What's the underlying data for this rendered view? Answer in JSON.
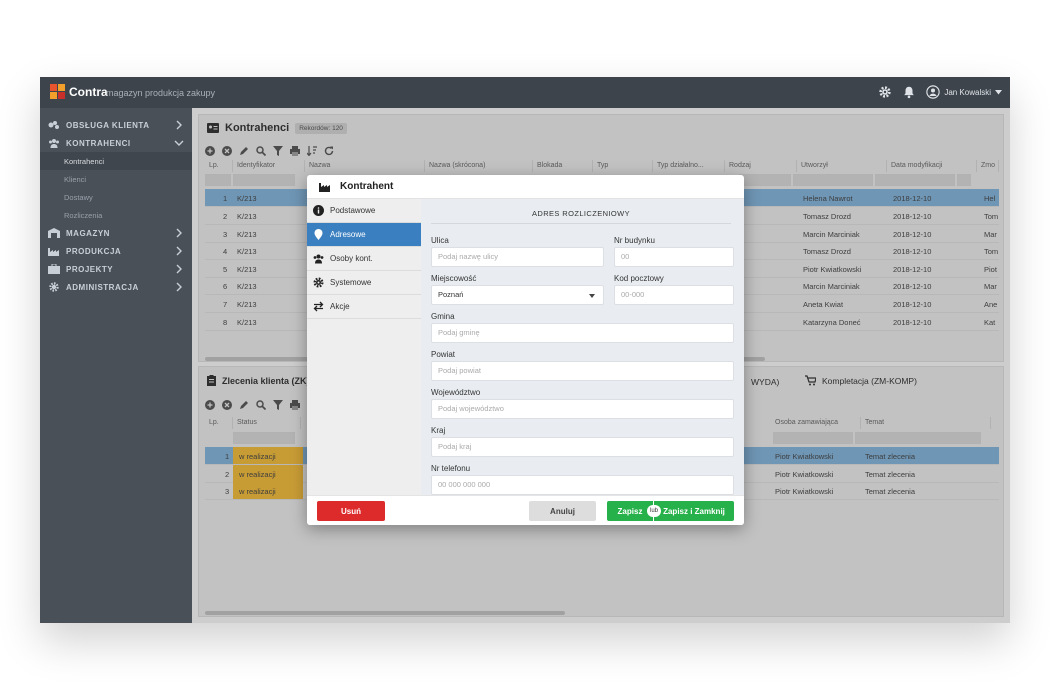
{
  "app": {
    "brand": "Contra",
    "brand_sub": "magazyn produkcja zakupy",
    "user_name": "Jan Kowalski",
    "colors": {
      "topbar": "#3d444c",
      "sidebar": "#4a5058",
      "accent": "#3a7fc0",
      "danger": "#dd2a2a",
      "success": "#27b14a"
    }
  },
  "sidebar": {
    "items": [
      {
        "label": "OBSŁUGA KLIENTA",
        "icon": "handshake-icon"
      },
      {
        "label": "KONTRAHENCI",
        "icon": "users-icon"
      },
      {
        "label": "MAGAZYN",
        "icon": "warehouse-icon"
      },
      {
        "label": "PRODUKCJA",
        "icon": "factory-icon"
      },
      {
        "label": "PROJEKTY",
        "icon": "projects-icon"
      },
      {
        "label": "ADMINISTRACJA",
        "icon": "gear-icon"
      }
    ],
    "subitems": [
      "Kontrahenci",
      "Klienci",
      "Dostawy",
      "Rozliczenia"
    ]
  },
  "kontrahenci": {
    "title": "Kontrahenci",
    "records_label": "Rekordów:",
    "records_count": "120",
    "columns": [
      "Lp.",
      "Identyfikator",
      "Nazwa",
      "Nazwa (skrócona)",
      "Blokada",
      "Typ",
      "Typ działalno...",
      "Rodzaj",
      "Utworzył",
      "Data modyfikacji",
      "Zmo"
    ],
    "rows": [
      {
        "lp": "1",
        "id": "K/213",
        "created_by": "Helena Nawrot",
        "modified": "2018-12-10",
        "last": "Hel"
      },
      {
        "lp": "2",
        "id": "K/213",
        "created_by": "Tomasz Drozd",
        "modified": "2018-12-10",
        "last": "Tom"
      },
      {
        "lp": "3",
        "id": "K/213",
        "created_by": "Marcin Marciniak",
        "modified": "2018-12-10",
        "last": "Mar"
      },
      {
        "lp": "4",
        "id": "K/213",
        "created_by": "Tomasz Drozd",
        "modified": "2018-12-10",
        "last": "Tom"
      },
      {
        "lp": "5",
        "id": "K/213",
        "created_by": "Piotr Kwiatkowski",
        "modified": "2018-12-10",
        "last": "Piot"
      },
      {
        "lp": "6",
        "id": "K/213",
        "created_by": "Marcin Marciniak",
        "modified": "2018-12-10",
        "last": "Mar"
      },
      {
        "lp": "7",
        "id": "K/213",
        "created_by": "Aneta Kwiat",
        "modified": "2018-12-10",
        "last": "Ane"
      },
      {
        "lp": "8",
        "id": "K/213",
        "created_by": "Katarzyna Doneć",
        "modified": "2018-12-10",
        "last": "Kat"
      }
    ]
  },
  "zlecenia": {
    "tab1": "Zlecenia klienta (ZK)",
    "tab2": "WYDA)",
    "tab3": "Kompletacja (ZM-KOMP)",
    "columns": [
      "Lp.",
      "Status",
      "Osoba zamawiająca",
      "Temat"
    ],
    "rows": [
      {
        "lp": "1",
        "status": "w realizacji",
        "person": "Piotr Kwiatkowski",
        "topic": "Temat zlecenia"
      },
      {
        "lp": "2",
        "status": "w realizacji",
        "person": "Piotr Kwiatkowski",
        "topic": "Temat zlecenia"
      },
      {
        "lp": "3",
        "status": "w realizacji",
        "person": "Piotr Kwiatkowski",
        "topic": "Temat zlecenia"
      }
    ]
  },
  "modal": {
    "title": "Kontrahent",
    "tabs": [
      "Podstawowe",
      "Adresowe",
      "Osoby kont.",
      "Systemowe",
      "Akcje"
    ],
    "section_title": "ADRES ROZLICZENIOWY",
    "fields": {
      "ulica": {
        "label": "Ulica",
        "placeholder": "Podaj nazwę ulicy"
      },
      "nr_budynku": {
        "label": "Nr budynku",
        "placeholder": "00"
      },
      "miejscowosc": {
        "label": "Miejscowość",
        "value": "Poznań"
      },
      "kod": {
        "label": "Kod pocztowy",
        "placeholder": "00-000"
      },
      "gmina": {
        "label": "Gmina",
        "placeholder": "Podaj gminę"
      },
      "powiat": {
        "label": "Powiat",
        "placeholder": "Podaj powiat"
      },
      "wojewodztwo": {
        "label": "Województwo",
        "placeholder": "Podaj województwo"
      },
      "kraj": {
        "label": "Kraj",
        "placeholder": "Podaj kraj"
      },
      "telefon": {
        "label": "Nr telefonu",
        "placeholder": "00 000 000 000"
      }
    },
    "buttons": {
      "delete": "Usuń",
      "cancel": "Anuluj",
      "save": "Zapisz",
      "or": "lub",
      "save_close": "Zapisz i Zamknij"
    }
  }
}
